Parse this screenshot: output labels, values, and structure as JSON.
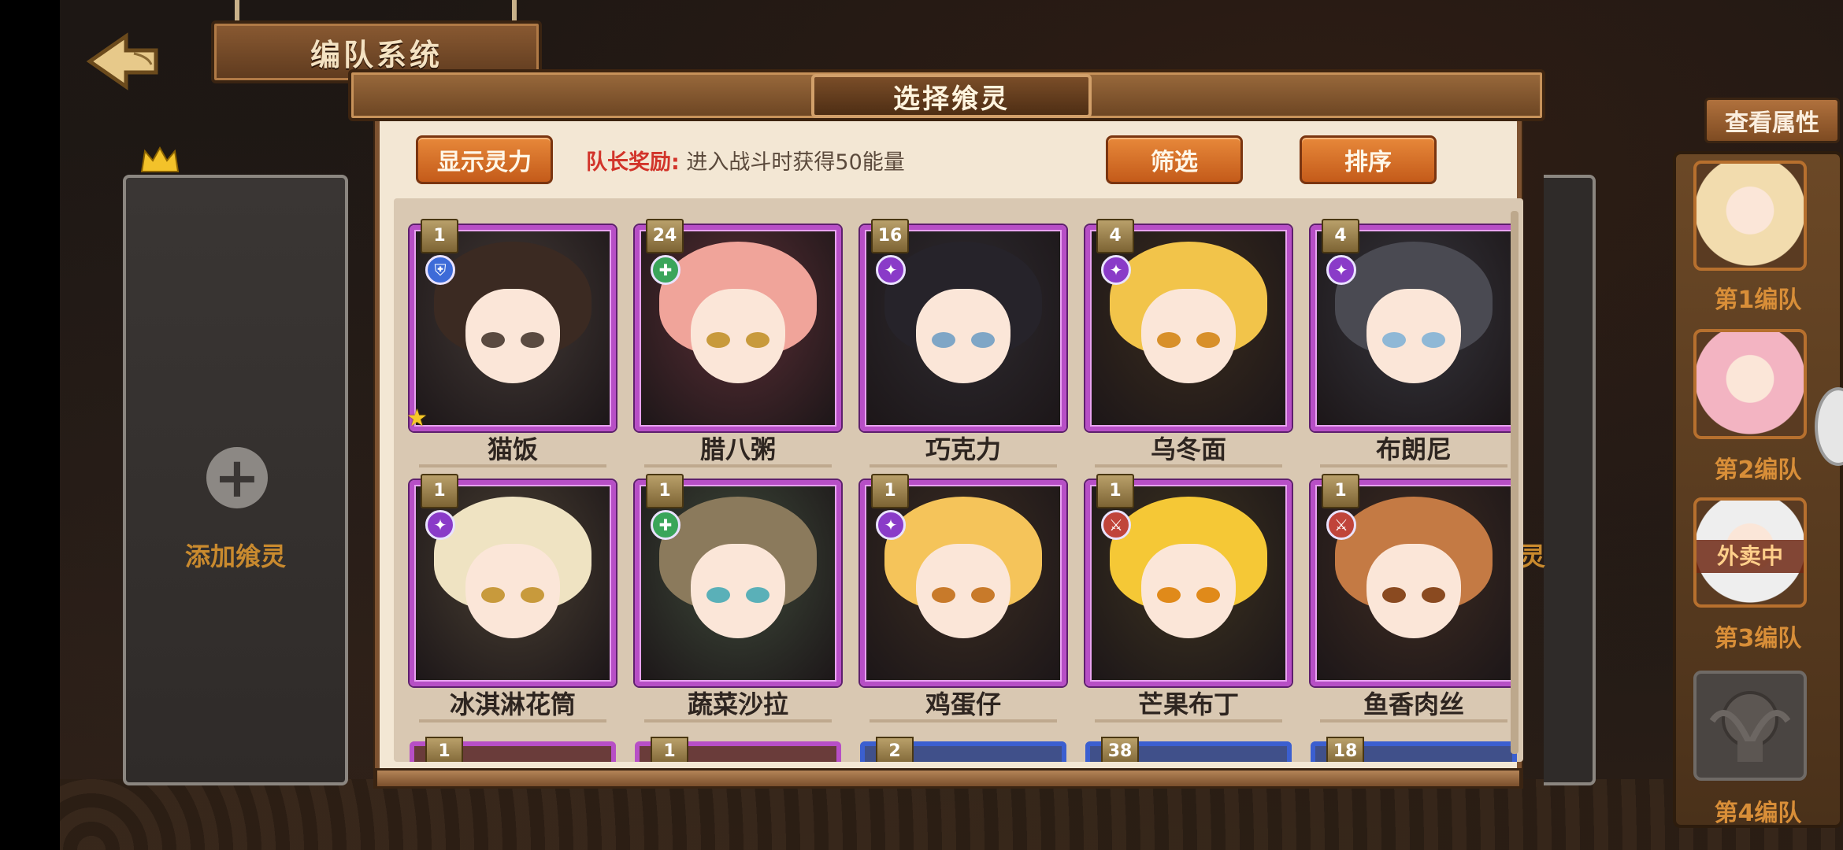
{
  "header": {
    "system_title": "编队系统",
    "dialog_title": "选择飨灵"
  },
  "toolbar": {
    "show_power_label": "显示灵力",
    "leader_bonus_key": "队长奖励:",
    "leader_bonus_text": "进入战斗时获得50能量",
    "filter_label": "筛选",
    "sort_label": "排序"
  },
  "left_slot": {
    "add_label": "添加飨灵",
    "right_partial_label": "灵"
  },
  "cards": [
    {
      "level": "1",
      "name": "猫饭",
      "type": "shield",
      "star": true,
      "hair": "#3b2a22",
      "eye": "#5a4a40",
      "bg": "#433a36"
    },
    {
      "level": "24",
      "name": "腊八粥",
      "type": "heal",
      "star": false,
      "hair": "#f0a49a",
      "eye": "#c89a3c",
      "bg": "#5a2e35"
    },
    {
      "level": "16",
      "name": "巧克力",
      "type": "magic",
      "star": false,
      "hair": "#26232a",
      "eye": "#7fa6c6",
      "bg": "#2e2b30"
    },
    {
      "level": "4",
      "name": "乌冬面",
      "type": "magic",
      "star": false,
      "hair": "#f2c44a",
      "eye": "#d8902a",
      "bg": "#3a2c1e"
    },
    {
      "level": "4",
      "name": "布朗尼",
      "type": "magic",
      "star": false,
      "hair": "#4a4a52",
      "eye": "#8fb8d6",
      "bg": "#35353c"
    },
    {
      "level": "1",
      "name": "冰淇淋花筒",
      "type": "magic",
      "star": false,
      "hair": "#efe3c2",
      "eye": "#c89a3c",
      "bg": "#4a4033"
    },
    {
      "level": "1",
      "name": "蔬菜沙拉",
      "type": "heal",
      "star": false,
      "hair": "#8b7a5c",
      "eye": "#5ab0b8",
      "bg": "#3e4a3a"
    },
    {
      "level": "1",
      "name": "鸡蛋仔",
      "type": "magic",
      "star": false,
      "hair": "#f5c45a",
      "eye": "#c87a2a",
      "bg": "#3b2d22"
    },
    {
      "level": "1",
      "name": "芒果布丁",
      "type": "attack",
      "star": false,
      "hair": "#f5c836",
      "eye": "#e08a1a",
      "bg": "#3d3320"
    },
    {
      "level": "1",
      "name": "鱼香肉丝",
      "type": "attack",
      "star": false,
      "hair": "#c47a44",
      "eye": "#8a4a20",
      "bg": "#3e2c22"
    }
  ],
  "peek_row": [
    {
      "level": "1",
      "color": "purple"
    },
    {
      "level": "1",
      "color": "purple"
    },
    {
      "level": "2",
      "color": "blue"
    },
    {
      "level": "38",
      "color": "blue"
    },
    {
      "level": "18",
      "color": "blue"
    }
  ],
  "side_panel": {
    "view_attr_label": "查看属性",
    "teams": [
      {
        "label": "第1编队",
        "busy": "",
        "hair": "#f2dcae"
      },
      {
        "label": "第2编队",
        "busy": "",
        "hair": "#f3b4c2"
      },
      {
        "label": "第3编队",
        "busy": "外卖中",
        "hair": "#eeeeee"
      },
      {
        "label": "第4编队",
        "busy": "",
        "hair": ""
      }
    ]
  },
  "colors": {
    "accent_orange": "#d9742c",
    "card_purple": "#b74fc6",
    "card_blue": "#3b5fd0",
    "bonus_red": "#d2342a"
  }
}
